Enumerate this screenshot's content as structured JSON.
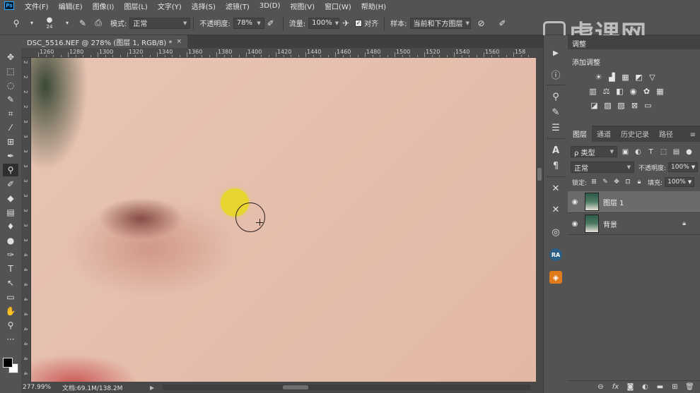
{
  "menu": {
    "logo": "Ps",
    "items": [
      "文件(F)",
      "编辑(E)",
      "图像(I)",
      "图层(L)",
      "文字(Y)",
      "选择(S)",
      "滤镜(T)",
      "3D(D)",
      "视图(V)",
      "窗口(W)",
      "帮助(H)"
    ]
  },
  "options_bar": {
    "brush_size": "24",
    "mode_label": "模式:",
    "mode_value": "正常",
    "opacity_label": "不透明度:",
    "opacity_value": "78%",
    "flow_label": "流量:",
    "flow_value": "100%",
    "aligned_label": "对齐",
    "aligned_checked": true,
    "sample_label": "样本:",
    "sample_value": "当前和下方图层"
  },
  "watermark": {
    "text": "虎课网"
  },
  "document": {
    "tab_title": "DSC_5516.NEF @ 278% (图层 1, RGB/8) *",
    "close_glyph": "×"
  },
  "ruler": {
    "h_labels": [
      "1260",
      "1280",
      "1300",
      "1320",
      "1340",
      "1360",
      "1380",
      "1400",
      "1420",
      "1440",
      "1460",
      "1480",
      "1500",
      "1520",
      "1540",
      "1560",
      "158"
    ],
    "v_labels": [
      "2",
      "2",
      "2",
      "2",
      "3",
      "3",
      "3",
      "3",
      "3",
      "3",
      "3",
      "3",
      "3",
      "4",
      "4",
      "4",
      "4",
      "4",
      "4",
      "4",
      "4",
      "4"
    ]
  },
  "status": {
    "zoom": "277.99%",
    "doc_info": "文档:69.1M/138.2M",
    "arrow": "▶"
  },
  "adjustments": {
    "tab_label": "调整",
    "title": "添加调整"
  },
  "layers": {
    "tabs": [
      "图层",
      "通道",
      "历史记录",
      "路径"
    ],
    "filter_kind": "ρ 类型",
    "blend_mode": "正常",
    "opacity_label": "不透明度:",
    "opacity_value": "100%",
    "lock_label": "锁定:",
    "fill_label": "填充:",
    "fill_value": "100%",
    "items": [
      {
        "name": "图层 1",
        "selected": true,
        "locked": false
      },
      {
        "name": "背景",
        "selected": false,
        "locked": true
      }
    ]
  },
  "colors": {
    "ui_bg": "#535353",
    "brush_sample": "#e8d628",
    "skin": "#e6bfae",
    "foreground": "#000000",
    "background": "#ffffff"
  }
}
